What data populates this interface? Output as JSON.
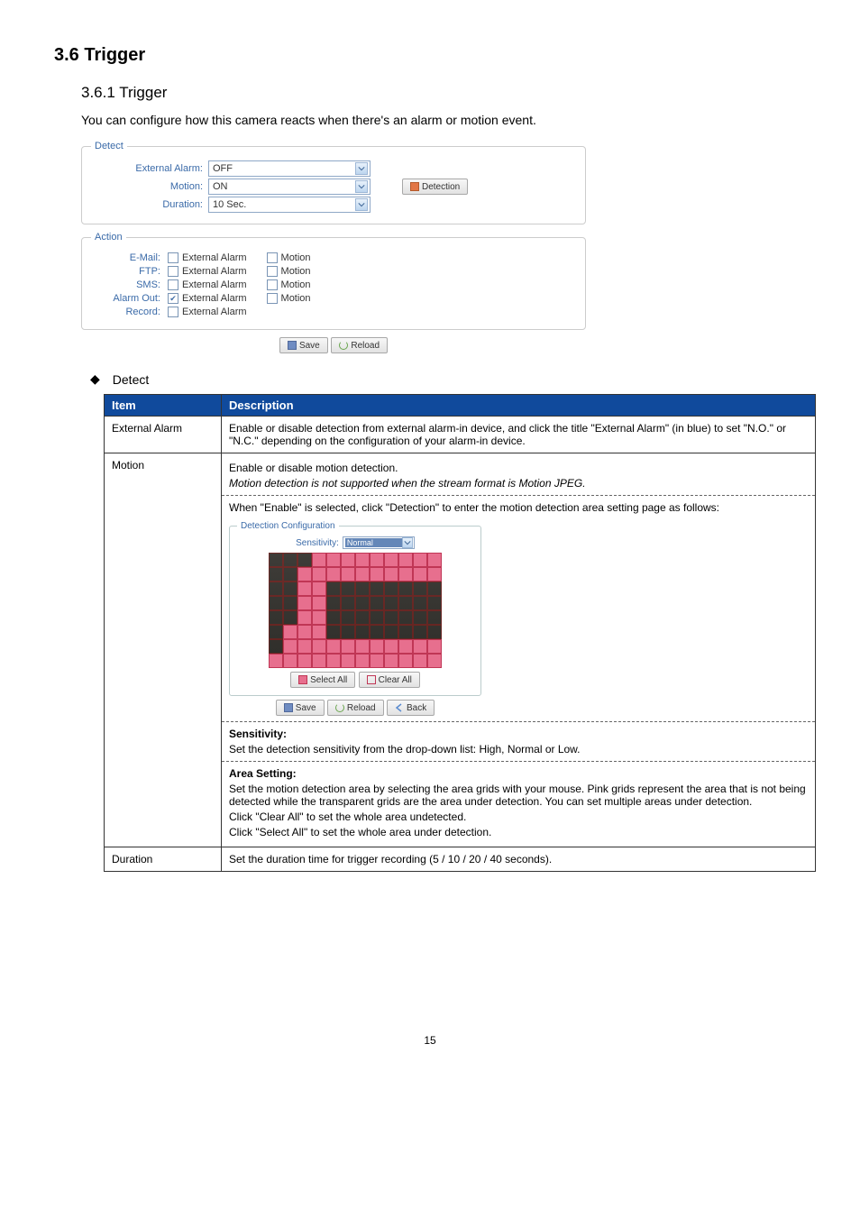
{
  "headings": {
    "h1": "3.6 Trigger",
    "h2": "3.6.1 Trigger",
    "intro": "You can configure how this camera reacts when there's an alarm or motion event."
  },
  "detect": {
    "legend": "Detect",
    "rows": {
      "ext_alarm_label": "External Alarm:",
      "ext_alarm_value": "OFF",
      "motion_label": "Motion:",
      "motion_value": "ON",
      "duration_label": "Duration:",
      "duration_value": "10 Sec."
    },
    "detection_btn": "Detection"
  },
  "action": {
    "legend": "Action",
    "rows": [
      {
        "label": "E-Mail:",
        "ext": false,
        "motion": false,
        "show_motion": true
      },
      {
        "label": "FTP:",
        "ext": false,
        "motion": false,
        "show_motion": true
      },
      {
        "label": "SMS:",
        "ext": false,
        "motion": false,
        "show_motion": true
      },
      {
        "label": "Alarm Out:",
        "ext": true,
        "motion": false,
        "show_motion": true
      },
      {
        "label": "Record:",
        "ext": false,
        "motion": false,
        "show_motion": false
      }
    ],
    "chk_ext": "External Alarm",
    "chk_motion": "Motion"
  },
  "buttons": {
    "save": "Save",
    "reload": "Reload",
    "select_all": "Select All",
    "clear_all": "Clear All",
    "back": "Back"
  },
  "bullet": {
    "diamond": "◆",
    "label": "Detect"
  },
  "table": {
    "head_item": "Item",
    "head_desc": "Description",
    "ext_alarm": {
      "item": "External Alarm",
      "desc": "Enable or disable detection from external alarm-in device, and click the title \"External Alarm\" (in blue) to set    \"N.O.\" or \"N.C.\" depending on the configuration of your alarm-in device."
    },
    "motion": {
      "item": "Motion",
      "p1": "Enable or disable motion detection.",
      "p2": "Motion detection is not supported when the stream format is Motion JPEG.",
      "p3": "When \"Enable\" is selected, click \"Detection\" to enter the motion detection area setting page as follows:",
      "sens_head": "Sensitivity:",
      "sens_body": "Set the detection sensitivity from the drop-down list: High, Normal or Low.",
      "area_head": "Area Setting:",
      "area_body1": "Set the motion detection area by selecting the area grids with your mouse. Pink grids represent the area that is not being detected while the transparent grids are the area under detection. You can set multiple areas under detection.",
      "area_body2": "Click \"Clear All\" to set the whole area undetected.",
      "area_body3": "Click \"Select All\" to set the whole area under detection.",
      "detcfg_legend": "Detection Configuration",
      "sens_label": "Sensitivity:",
      "sens_value": "Normal"
    },
    "duration": {
      "item": "Duration",
      "desc": "Set the duration time for trigger recording (5 / 10 / 20 / 40 seconds)."
    }
  },
  "pagenum": "15"
}
